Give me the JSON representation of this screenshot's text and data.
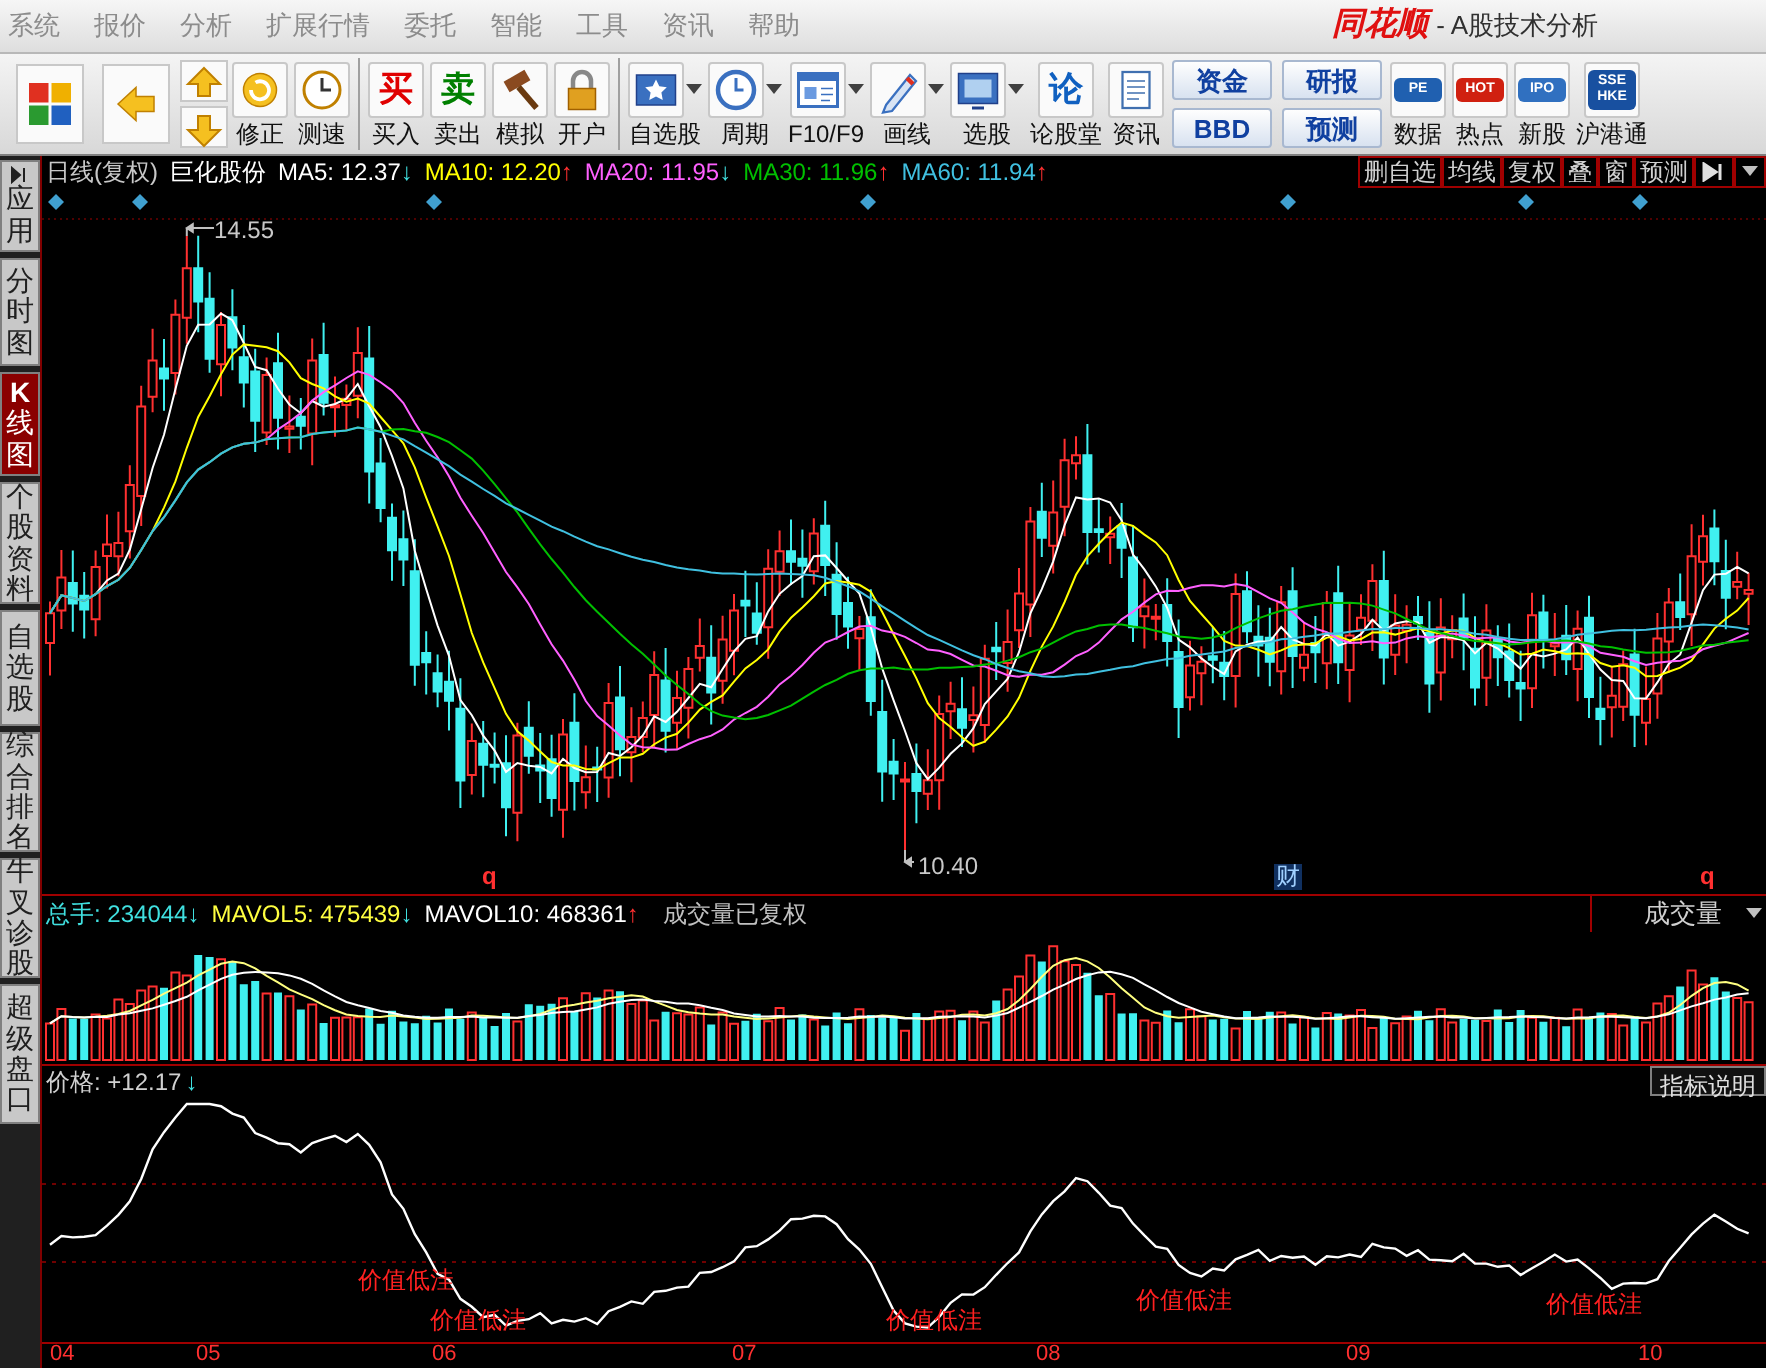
{
  "menu": [
    {
      "label": "系统"
    },
    {
      "label": "报价"
    },
    {
      "label": "分析"
    },
    {
      "label": "扩展行情"
    },
    {
      "label": "委托"
    },
    {
      "label": "智能"
    },
    {
      "label": "工具"
    },
    {
      "label": "资讯"
    },
    {
      "label": "帮助"
    }
  ],
  "brand": {
    "logo": "同花顺",
    "title": "- A股技术分析"
  },
  "toolbar": [
    {
      "kind": "tiles",
      "dropdown": false
    },
    {
      "kind": "back",
      "dropdown": false
    },
    {
      "kind": "updown"
    },
    {
      "kind": "refresh",
      "label": "修正",
      "dropdown": false
    },
    {
      "kind": "clock",
      "label": "测速",
      "dropdown": false
    },
    {
      "kind": "glyph",
      "glyph": "买",
      "color": "#e00000",
      "label": "买入",
      "dropdown": false
    },
    {
      "kind": "glyph",
      "glyph": "卖",
      "color": "#008000",
      "label": "卖出",
      "dropdown": false
    },
    {
      "kind": "hammer",
      "label": "模拟",
      "dropdown": false
    },
    {
      "kind": "lock",
      "label": "开户",
      "dropdown": false
    },
    {
      "kind": "star",
      "label": "自选股",
      "dropdown": true
    },
    {
      "kind": "dial",
      "label": "周期",
      "dropdown": true
    },
    {
      "kind": "window",
      "label": "F10/F9",
      "dropdown": true
    },
    {
      "kind": "pencil",
      "label": "画线",
      "dropdown": true
    },
    {
      "kind": "monitor",
      "label": "选股",
      "dropdown": true
    },
    {
      "kind": "glyph",
      "glyph": "论",
      "color": "#1060c0",
      "label": "论股堂",
      "dropdown": false
    },
    {
      "kind": "document",
      "label": "资讯",
      "dropdown": false
    },
    {
      "kind": "pair",
      "top": "资金",
      "bottom": "BBD"
    },
    {
      "kind": "pair",
      "top": "研报",
      "bottom": "预测"
    },
    {
      "kind": "badge",
      "badge": "PE",
      "color": "#2060b0",
      "label": "数据",
      "dropdown": false
    },
    {
      "kind": "badge",
      "badge": "HOT",
      "color": "#d02010",
      "label": "热点",
      "dropdown": false
    },
    {
      "kind": "badge",
      "badge": "IPO",
      "color": "#3070c0",
      "label": "新股",
      "dropdown": false
    },
    {
      "kind": "badge",
      "badge": "SSE HKE",
      "color": "#1850a0",
      "label": "沪港通",
      "dropdown": false
    }
  ],
  "side_tabs": [
    {
      "label": "应用",
      "selected": false
    },
    {
      "label": "分时图",
      "selected": false
    },
    {
      "label": "**K**线图",
      "selected": true
    },
    {
      "label": "个股资料",
      "selected": false
    },
    {
      "label": "自选股",
      "selected": false
    },
    {
      "label": "综合排名",
      "selected": false
    },
    {
      "label": "牛叉诊股",
      "selected": false
    },
    {
      "label": "超级盘口",
      "selected": false
    }
  ],
  "chart": {
    "period": "日线(复权)",
    "stock": "巨化股份",
    "moving_averages": [
      {
        "label": "MA5:",
        "value": "12.37",
        "arrow": {
          "text": "↓",
          "color": "#40e0e0"
        },
        "color": "#ffffff"
      },
      {
        "label": "MA10:",
        "value": "12.20",
        "arrow": {
          "text": "↑",
          "color": "#ff3030"
        },
        "color": "#ffff00"
      },
      {
        "label": "MA20:",
        "value": "11.95",
        "arrow": {
          "text": "↓",
          "color": "#40e0e0"
        },
        "color": "#ff60ff"
      },
      {
        "label": "MA30:",
        "value": "11.96",
        "arrow": {
          "text": "↑",
          "color": "#ff3030"
        },
        "color": "#00c000"
      },
      {
        "label": "MA60:",
        "value": "11.94",
        "arrow": {
          "text": "↑",
          "color": "#ff3030"
        },
        "color": "#40c0e0"
      }
    ],
    "buttons": [
      {
        "label": "删自选"
      },
      {
        "label": "均线"
      },
      {
        "label": "复权"
      },
      {
        "label": "叠"
      },
      {
        "label": "窗"
      },
      {
        "label": "预测"
      }
    ],
    "high_label": "14.55",
    "low_label": "10.40",
    "event_marks": [
      {
        "kind": "q",
        "text": "q"
      },
      {
        "kind": "finance",
        "text": "财"
      },
      {
        "kind": "q",
        "text": "q"
      }
    ]
  },
  "volume": {
    "readings": [
      {
        "label": "总手:",
        "value": "234044",
        "arrow": {
          "text": "↓",
          "color": "#40e0e0"
        },
        "color": "#40e0e0"
      },
      {
        "label": "MAVOL5:",
        "value": "475439",
        "arrow": {
          "text": "↓",
          "color": "#40e0e0"
        },
        "color": "#ffff40"
      },
      {
        "label": "MAVOL10:",
        "value": "468361",
        "arrow": {
          "text": "↑",
          "color": "#ff3030"
        },
        "color": "#ffffff"
      }
    ],
    "note": "成交量已复权",
    "selector": "成交量"
  },
  "indicator": {
    "label": "价格:",
    "value": "+12.17",
    "arrow": {
      "text": "↓",
      "color": "#40e0e0"
    },
    "help_button": "指标说明",
    "signals": [
      {
        "text": "价值低洼"
      },
      {
        "text": "价值低洼"
      },
      {
        "text": "价值低洼"
      },
      {
        "text": "价值低洼"
      },
      {
        "text": "价值低洼"
      }
    ],
    "months": [
      "04",
      "05",
      "06",
      "07",
      "08",
      "09",
      "10"
    ]
  }
}
